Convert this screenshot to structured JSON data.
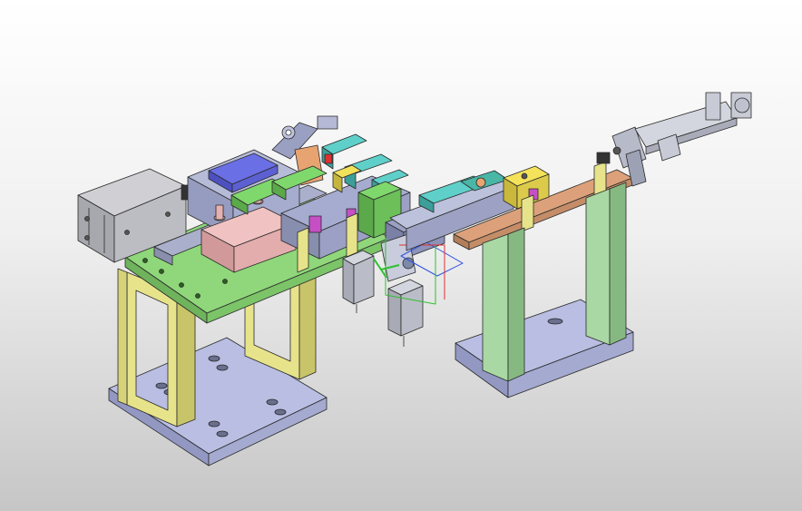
{
  "view": {
    "background_top": "#ffffff",
    "background_bottom": "#c6c6c6"
  },
  "model": {
    "colors": {
      "plate_green": "#8ed67a",
      "frame_yellow": "#e8e48a",
      "base_blue": "#b8bde0",
      "steel": "#b5b8c8",
      "copper": "#d9a07a",
      "column_green": "#a9d8a4",
      "block_pink": "#e9b3b3",
      "pad_blue": "#6f73e6",
      "magenta": "#c64fc6",
      "yellow_block": "#f4e25a",
      "cyan": "#5fd0c9",
      "teal": "#49b6a6"
    }
  },
  "triad": {
    "axes": [
      "x-axis",
      "y-axis",
      "z-axis"
    ],
    "colors": [
      "#e03030",
      "#30c030",
      "#3050e0"
    ]
  }
}
